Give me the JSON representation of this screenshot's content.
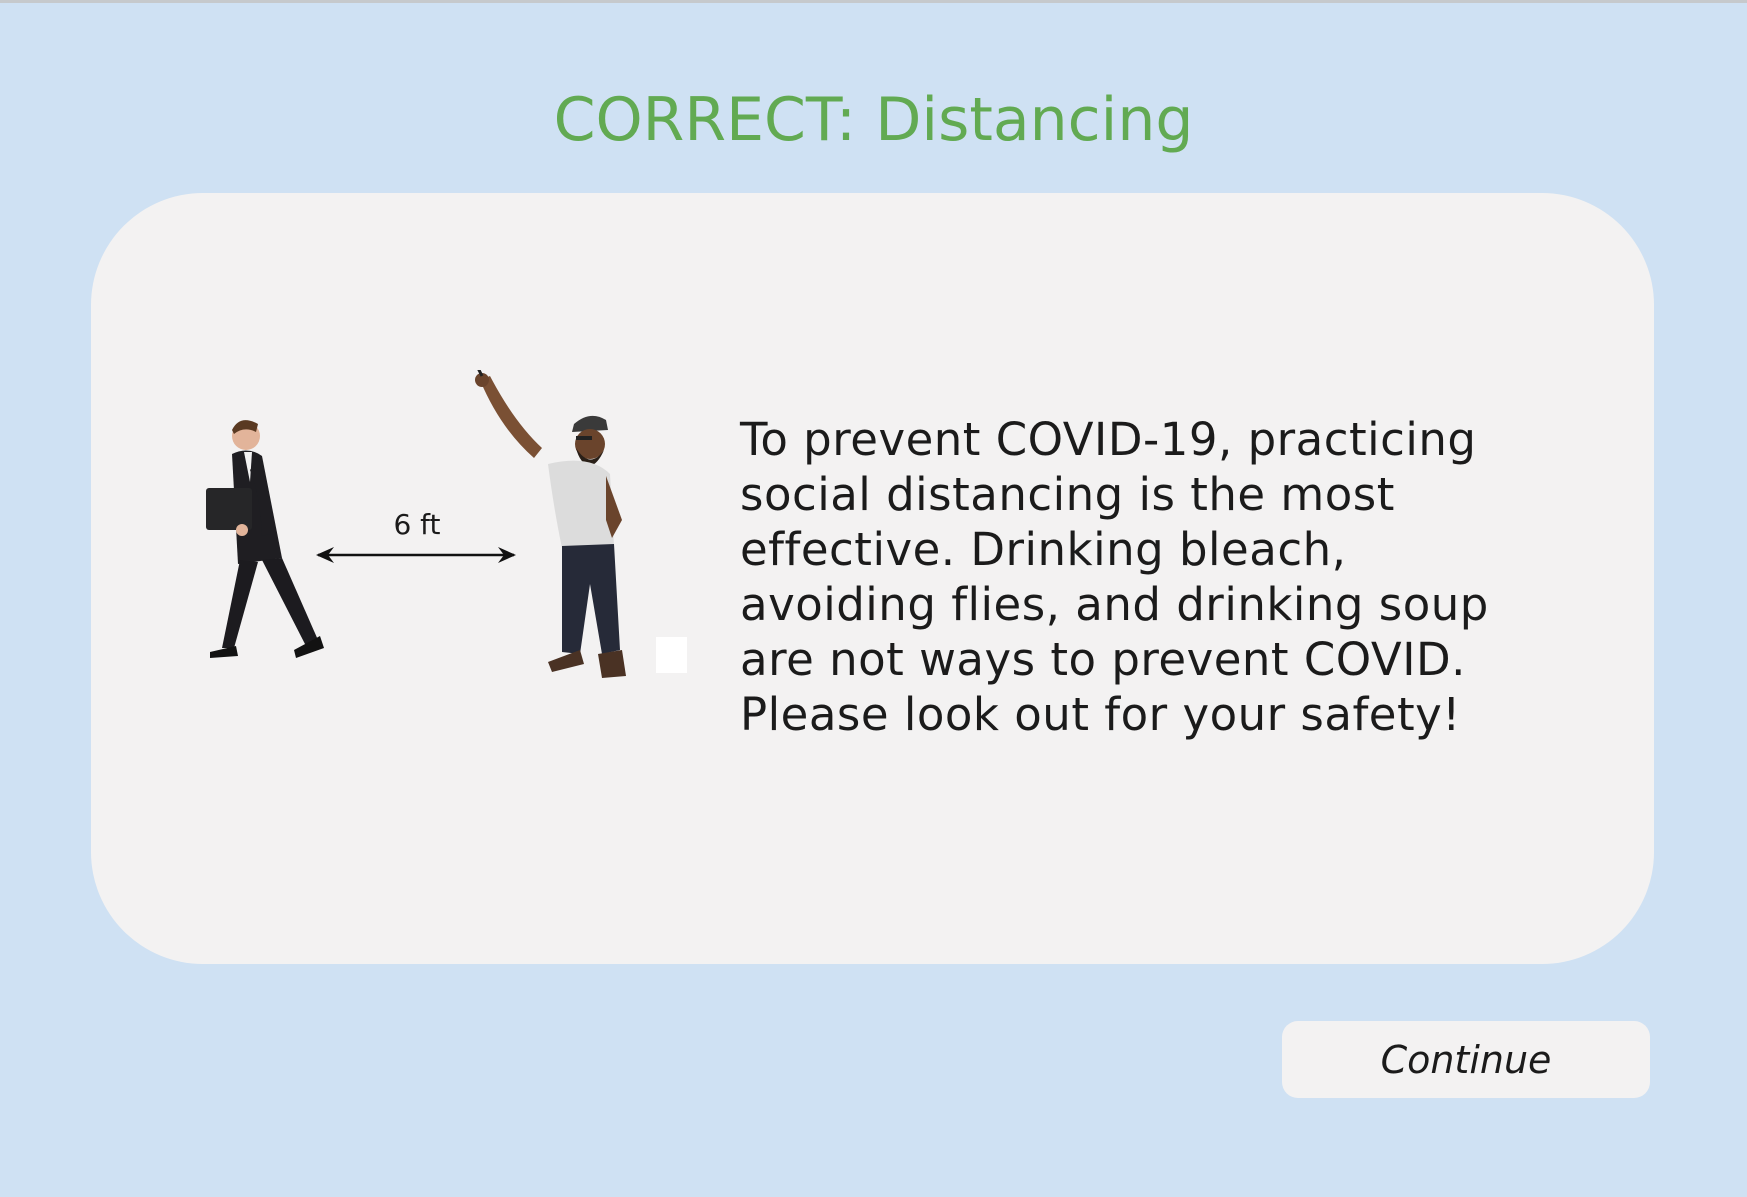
{
  "header": {
    "title_strong": "CORRECT:",
    "title_rest": " Distancing"
  },
  "illustration": {
    "distance_label": "6 ft"
  },
  "message": {
    "lines": [
      "To prevent COVID-19, practicing",
      "social distancing is the most",
      "effective. Drinking bleach,",
      "avoiding flies, and drinking soup",
      "are not ways to prevent COVID.",
      "Please look out for your safety!"
    ]
  },
  "footer": {
    "continue_label": "Continue"
  },
  "colors": {
    "background": "#cfe1f3",
    "card": "#f3f2f2",
    "title_green": "#62aa52",
    "text": "#1b1b1b"
  }
}
